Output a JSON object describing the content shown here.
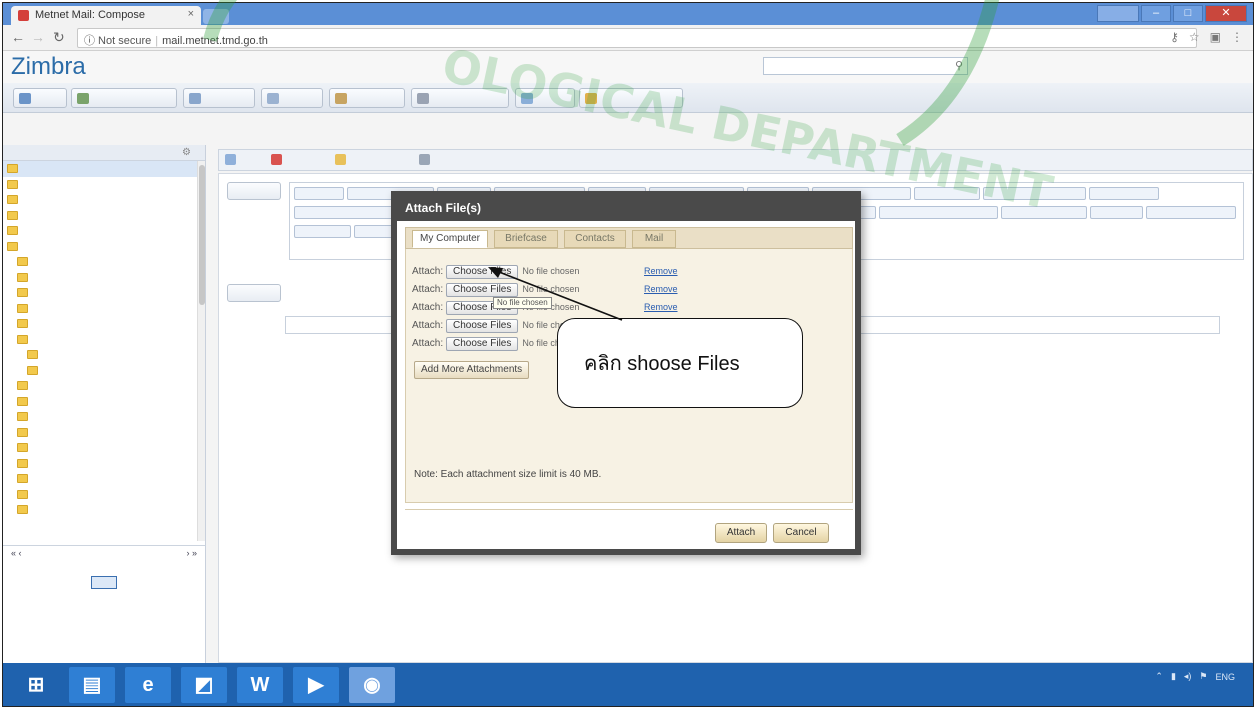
{
  "browser": {
    "tab_title": "Metnet Mail: Compose",
    "tab_close": "×",
    "address_security": "ⓘ Not secure",
    "address_host": "mail.metnet.tmd.go.th",
    "address_rest": "",
    "window_user": "",
    "win_min": "–",
    "win_max": "□",
    "win_close": "✕"
  },
  "app": {
    "logo": "Zimbra",
    "account": "",
    "header_links": [
      "",
      ""
    ]
  },
  "app_tabs": [
    "",
    "",
    "",
    "",
    "",
    "",
    "",
    ""
  ],
  "folders": {
    "header": "",
    "items": [
      {
        "label": "",
        "color": "#f2c94c",
        "indent": 0
      },
      {
        "label": "",
        "color": "#f2c94c",
        "indent": 0
      },
      {
        "label": "",
        "color": "#f2c94c",
        "indent": 0
      },
      {
        "label": "",
        "color": "#f2c94c",
        "indent": 0
      },
      {
        "label": "",
        "color": "#f2c94c",
        "indent": 0
      },
      {
        "label": "",
        "color": "#f2c94c",
        "indent": 0
      },
      {
        "label": "",
        "color": "#f2c94c",
        "indent": 1
      },
      {
        "label": "",
        "color": "#f2c94c",
        "indent": 1
      },
      {
        "label": "",
        "color": "#f2c94c",
        "indent": 1
      },
      {
        "label": "",
        "color": "#f2c94c",
        "indent": 1
      },
      {
        "label": "",
        "color": "#f2c94c",
        "indent": 1
      },
      {
        "label": "",
        "color": "#f2c94c",
        "indent": 1
      },
      {
        "label": "",
        "color": "#f2c94c",
        "indent": 2
      },
      {
        "label": "",
        "color": "#f2c94c",
        "indent": 2
      },
      {
        "label": "",
        "color": "#f2c94c",
        "indent": 1
      },
      {
        "label": "",
        "color": "#f2c94c",
        "indent": 1
      },
      {
        "label": "",
        "color": "#f2c94c",
        "indent": 1
      },
      {
        "label": "",
        "color": "#f2c94c",
        "indent": 1
      },
      {
        "label": "",
        "color": "#f2c94c",
        "indent": 1
      },
      {
        "label": "",
        "color": "#f2c94c",
        "indent": 1
      },
      {
        "label": "",
        "color": "#f2c94c",
        "indent": 1
      },
      {
        "label": "",
        "color": "#f2c94c",
        "indent": 1
      },
      {
        "label": "",
        "color": "#f2c94c",
        "indent": 1
      }
    ]
  },
  "calendar": {
    "prev": "«  ‹",
    "month": "",
    "next": "›  »",
    "days": [
      "",
      "",
      "",
      "",
      "",
      "",
      "",
      "",
      "",
      "",
      "",
      "",
      "",
      "",
      "",
      "",
      "",
      "",
      "",
      "",
      "",
      "",
      "",
      "",
      "",
      "",
      "",
      "",
      "",
      "",
      "",
      "",
      "",
      "",
      "",
      "",
      "",
      "",
      "",
      "",
      "",
      ""
    ],
    "today_index": 10
  },
  "compose": {
    "toolbar": [
      "",
      "",
      "",
      ""
    ],
    "to_label": "",
    "recipients": [
      "",
      "",
      "",
      "",
      "",
      "",
      "",
      "",
      "",
      "",
      "",
      "",
      "",
      "",
      "",
      "",
      "",
      "",
      "",
      "",
      "",
      "",
      "",
      "",
      "",
      "",
      "",
      ""
    ],
    "cc_label": "",
    "subject_label": "",
    "subject_value": "",
    "priority_label": "",
    "body_text": ""
  },
  "dialog": {
    "title": "Attach File(s)",
    "tabs": [
      "My Computer",
      "Briefcase",
      "Contacts",
      "Mail"
    ],
    "active_tab": 0,
    "attach_label": "Attach:",
    "choose_label": "Choose Files",
    "no_file_label": "No file chosen",
    "remove_label": "Remove",
    "tooltip": "No file chosen",
    "add_more_label": "Add More Attachments",
    "note": "Note: Each attachment size limit is 40 MB.",
    "attach_button": "Attach",
    "cancel_button": "Cancel"
  },
  "callout": {
    "text": "คลิก shoose Files"
  },
  "taskbar": {
    "items": [
      {
        "icon": "windows-start-icon",
        "color": "#1f62ae"
      },
      {
        "icon": "file-explorer-icon",
        "color": "#2f7fd4"
      },
      {
        "icon": "internet-explorer-icon",
        "color": "#2f7fd4"
      },
      {
        "icon": "photos-icon",
        "color": "#2f7fd4"
      },
      {
        "icon": "word-icon",
        "color": "#2f7fd4"
      },
      {
        "icon": "media-player-icon",
        "color": "#2f7fd4"
      },
      {
        "icon": "chrome-icon",
        "color": "#6fa1df"
      }
    ],
    "time": "",
    "date": ""
  },
  "colors": {
    "accent": "#2b6ca8",
    "taskbar": "#1f62ae",
    "dialog_frame": "#4a4a4a",
    "watermark": "#2e9e3a"
  }
}
